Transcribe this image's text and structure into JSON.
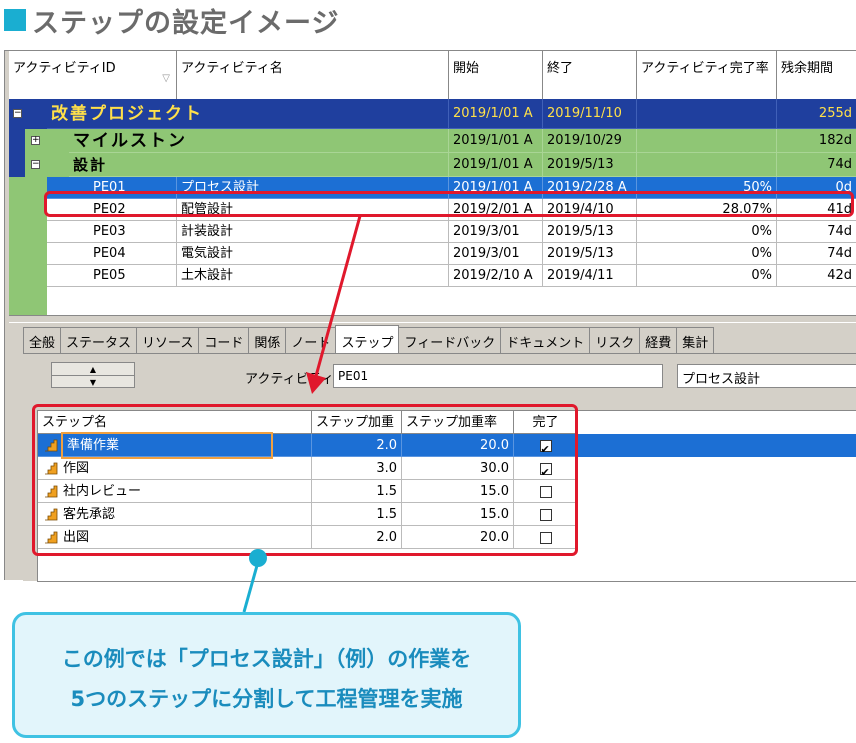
{
  "heading": "ステップの設定イメージ",
  "columns": {
    "id": "アクティビティID",
    "name": "アクティビティ名",
    "start": "開始",
    "end": "終了",
    "pct": "アクティビティ完了率",
    "remain": "残余期間"
  },
  "project": {
    "name": "改善プロジェクト",
    "start": "2019/1/01 A",
    "end": "2019/11/10",
    "remain": "255d"
  },
  "milestone": {
    "name": "マイルストン",
    "start": "2019/1/01 A",
    "end": "2019/10/29",
    "remain": "182d"
  },
  "design": {
    "name": "設計",
    "start": "2019/1/01 A",
    "end": "2019/5/13",
    "remain": "74d"
  },
  "activities": [
    {
      "id": "PE01",
      "name": "プロセス設計",
      "start": "2019/1/01 A",
      "end": "2019/2/28 A",
      "pct": "50%",
      "remain": "0d"
    },
    {
      "id": "PE02",
      "name": "配管設計",
      "start": "2019/2/01 A",
      "end": "2019/4/10",
      "pct": "28.07%",
      "remain": "41d"
    },
    {
      "id": "PE03",
      "name": "計装設計",
      "start": "2019/3/01",
      "end": "2019/5/13",
      "pct": "0%",
      "remain": "74d"
    },
    {
      "id": "PE04",
      "name": "電気設計",
      "start": "2019/3/01",
      "end": "2019/5/13",
      "pct": "0%",
      "remain": "74d"
    },
    {
      "id": "PE05",
      "name": "土木設計",
      "start": "2019/2/10 A",
      "end": "2019/4/11",
      "pct": "0%",
      "remain": "42d"
    }
  ],
  "tabs": [
    "全般",
    "ステータス",
    "リソース",
    "コード",
    "関係",
    "ノート",
    "ステップ",
    "フィードバック",
    "ドキュメント",
    "リスク",
    "経費",
    "集計"
  ],
  "active_tab": "ステップ",
  "detail": {
    "activity_label": "アクティビティ",
    "activity_id": "PE01",
    "activity_name": "プロセス設計"
  },
  "step_columns": {
    "name": "ステップ名",
    "weight": "ステップ加重",
    "weight_pct": "ステップ加重率",
    "done": "完了"
  },
  "steps": [
    {
      "name": "準備作業",
      "weight": "2.0",
      "weight_pct": "20.0",
      "done": true
    },
    {
      "name": "作図",
      "weight": "3.0",
      "weight_pct": "30.0",
      "done": true
    },
    {
      "name": "社内レビュー",
      "weight": "1.5",
      "weight_pct": "15.0",
      "done": false
    },
    {
      "name": "客先承認",
      "weight": "1.5",
      "weight_pct": "15.0",
      "done": false
    },
    {
      "name": "出図",
      "weight": "2.0",
      "weight_pct": "20.0",
      "done": false
    }
  ],
  "callout": {
    "line1": "この例では「プロセス設計」（例）の作業を",
    "line2": "5つのステップに分割して工程管理を実施"
  },
  "colors": {
    "accent": "#1aaed1",
    "project_bar": "#1f3f9e",
    "wbs_bar": "#8fc675",
    "selection": "#1c6fd4",
    "highlight_red": "#e0182c"
  },
  "icons": {
    "expand": "plus-box-icon",
    "collapse": "minus-box-icon",
    "step": "step-icon",
    "spin_up": "arrow-up-icon",
    "spin_down": "arrow-down-icon"
  }
}
